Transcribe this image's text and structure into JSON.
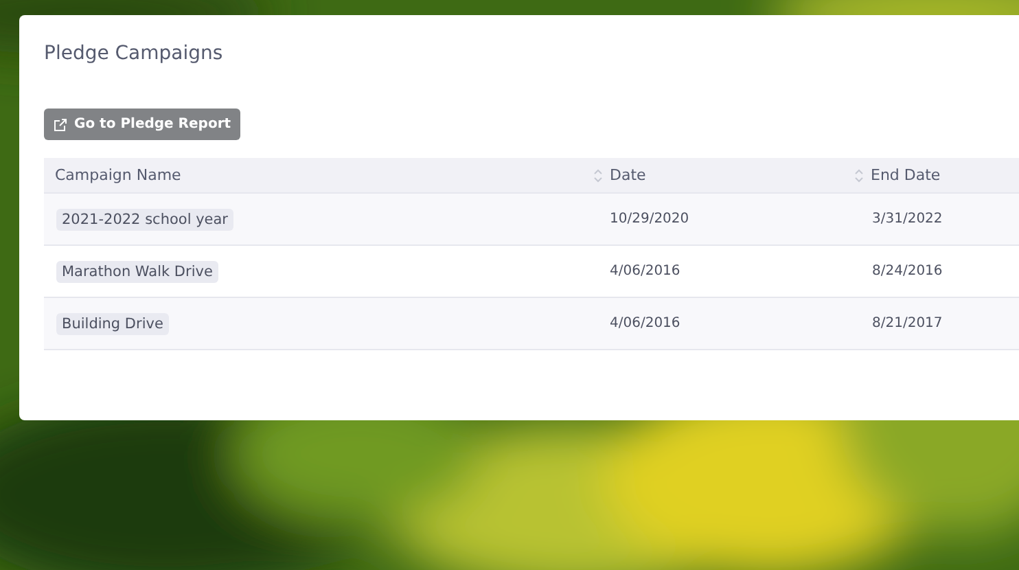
{
  "card": {
    "title": "Pledge Campaigns"
  },
  "report_button": {
    "label": "Go to Pledge Report"
  },
  "table": {
    "columns": [
      {
        "label": "Campaign Name",
        "sortable": false
      },
      {
        "label": "Date",
        "sortable": true
      },
      {
        "label": "End Date",
        "sortable": true
      }
    ],
    "rows": [
      {
        "name": "2021-2022 school year",
        "date": "10/29/2020",
        "end_date": "3/31/2022"
      },
      {
        "name": "Marathon Walk Drive",
        "date": "4/06/2016",
        "end_date": "8/24/2016"
      },
      {
        "name": "Building Drive",
        "date": "4/06/2016",
        "end_date": "8/21/2017"
      }
    ]
  }
}
